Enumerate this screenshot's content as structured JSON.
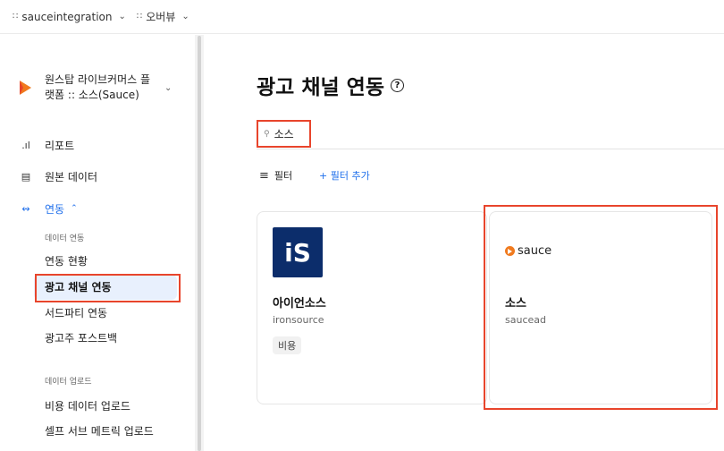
{
  "topbar": {
    "workspace": "sauceintegration",
    "view": "오버뷰"
  },
  "sidebar": {
    "workspace_name": "원스탑 라이브커머스 플랫폼 :: 소스(Sauce)",
    "items": {
      "report": "리포트",
      "raw_data": "원본 데이터",
      "integration": "연동"
    },
    "data_integration_head": "데이터 연동",
    "sub_items": {
      "status": "연동 현황",
      "ad_channel": "광고 채널 연동",
      "third_party": "서드파티 연동",
      "advertiser_postback": "광고주 포스트백"
    },
    "data_upload_head": "데이터 업로드",
    "upload_items": {
      "cost_upload": "비용 데이터 업로드",
      "self_serve": "셀프 서브 메트릭 업로드"
    }
  },
  "main": {
    "title": "광고 채널 연동",
    "help_icon_text": "?",
    "search_value": "소스",
    "filter_label": "필터",
    "add_filter_label": "+ 필터 추가",
    "cards": [
      {
        "logo_text": "iS",
        "title": "아이언소스",
        "sub": "ironsource",
        "badge": "비용"
      },
      {
        "logo_text": "sauce",
        "title": "소스",
        "sub": "saucead"
      }
    ]
  },
  "colors": {
    "accent": "#1f6feb",
    "highlight": "#e8452c",
    "ironsource": "#0c2d6b",
    "sauce_orange": "#f07a1e"
  }
}
